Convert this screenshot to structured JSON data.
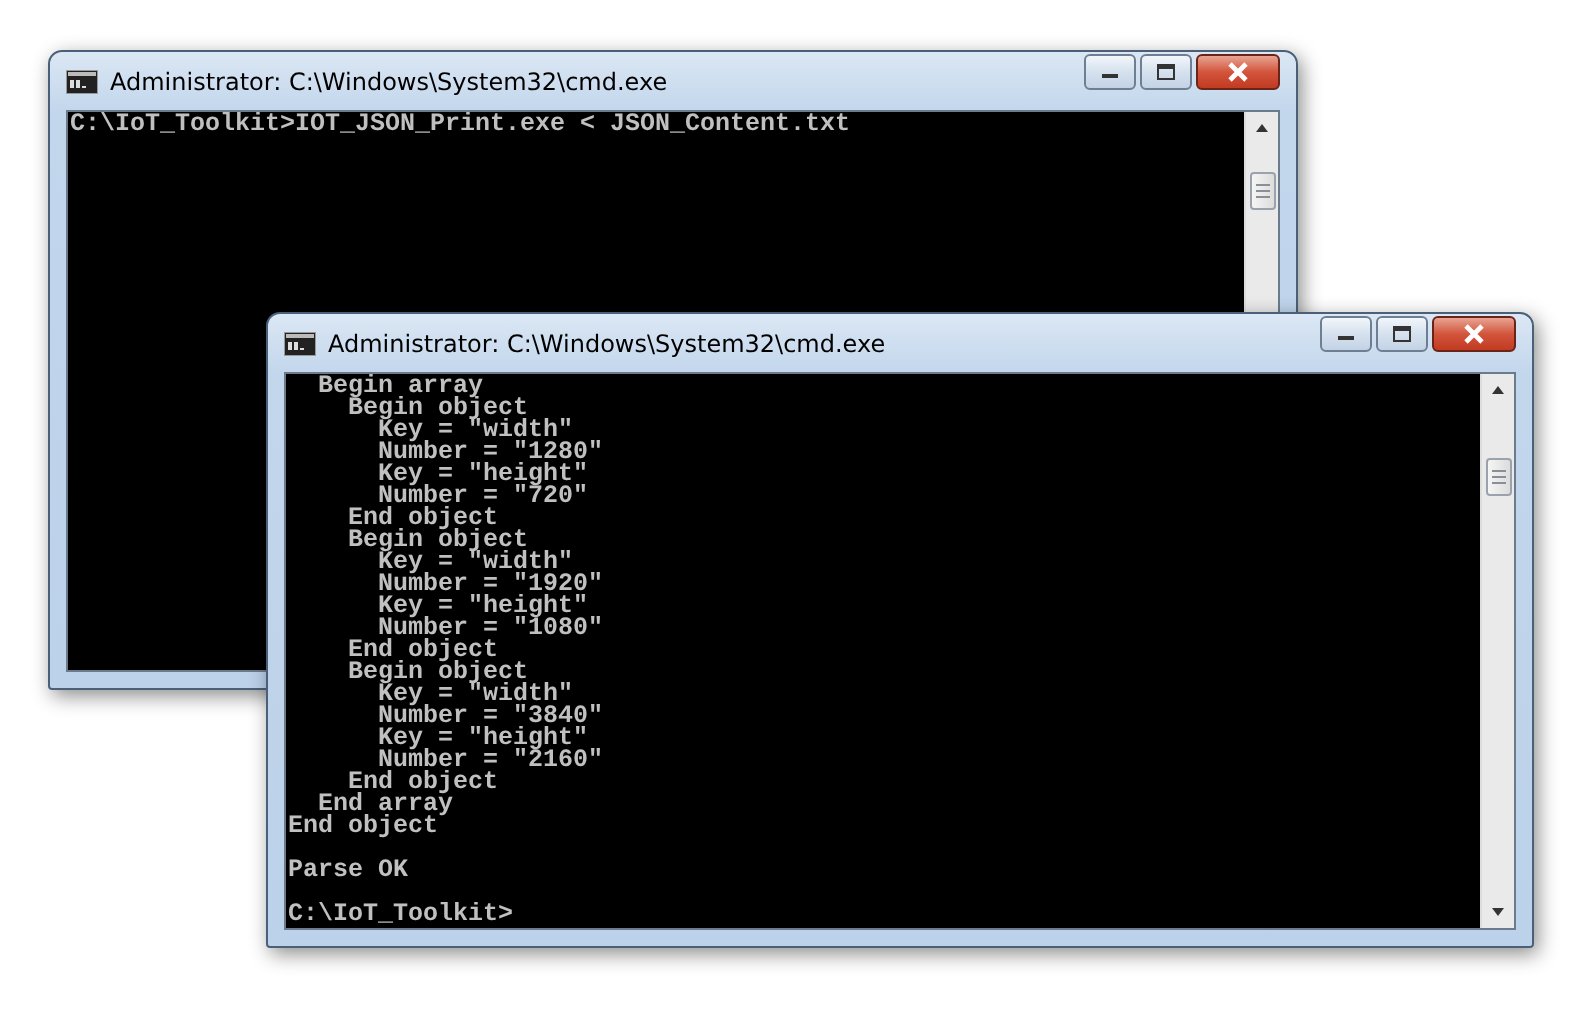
{
  "windows": [
    {
      "title": "Administrator: C:\\Windows\\System32\\cmd.exe",
      "output": [
        "C:\\IoT_Toolkit>IOT_JSON_Print.exe < JSON_Content.txt"
      ]
    },
    {
      "title": "Administrator: C:\\Windows\\System32\\cmd.exe",
      "output": [
        "  Begin array",
        "    Begin object",
        "      Key = \"width\"",
        "      Number = \"1280\"",
        "      Key = \"height\"",
        "      Number = \"720\"",
        "    End object",
        "    Begin object",
        "      Key = \"width\"",
        "      Number = \"1920\"",
        "      Key = \"height\"",
        "      Number = \"1080\"",
        "    End object",
        "    Begin object",
        "      Key = \"width\"",
        "      Number = \"3840\"",
        "      Key = \"height\"",
        "      Number = \"2160\"",
        "    End object",
        "  End array",
        "End object"
      ],
      "status": "Parse OK",
      "prompt": "C:\\IoT_Toolkit>"
    }
  ]
}
